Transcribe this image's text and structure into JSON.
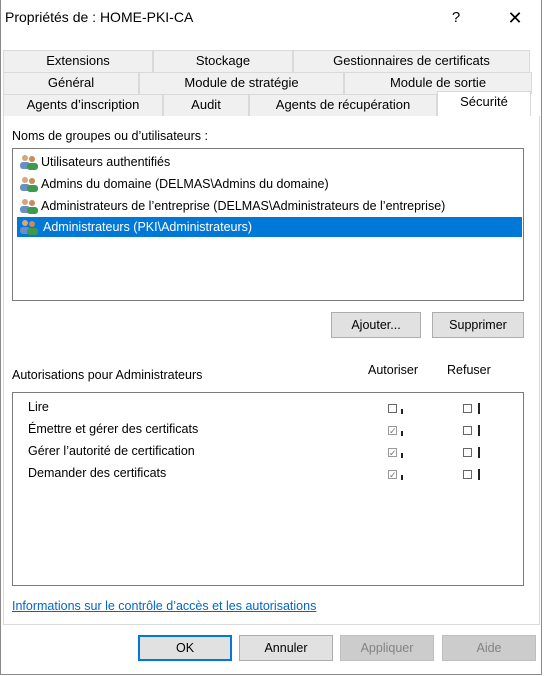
{
  "window": {
    "title": "Propriétés de : HOME-PKI-CA",
    "help_label": "?",
    "close_label": "✕"
  },
  "tabs": {
    "row1": [
      "Extensions",
      "Stockage",
      "Gestionnaires de certificats"
    ],
    "row2": [
      "Général",
      "Module de stratégie",
      "Module de sortie"
    ],
    "row3": [
      "Agents d’inscription",
      "Audit",
      "Agents de récupération",
      "Sécurité"
    ],
    "active": "Sécurité"
  },
  "groups": {
    "label": "Noms de groupes ou d’utilisateurs :",
    "items": [
      {
        "name": "Utilisateurs authentifiés",
        "icon": "users-group-icon"
      },
      {
        "name": "Admins du domaine (DELMAS\\Admins du domaine)",
        "icon": "users-group-icon"
      },
      {
        "name": "Administrateurs de l’entreprise (DELMAS\\Administrateurs de l’entreprise)",
        "icon": "users-group-icon"
      },
      {
        "name": "Administrateurs (PKI\\Administrateurs)",
        "icon": "users-group-icon",
        "selected": true
      }
    ],
    "add_label": "Ajouter...",
    "remove_label": "Supprimer"
  },
  "permissions": {
    "label": "Autorisations pour Administrateurs",
    "allow_header": "Autoriser",
    "deny_header": "Refuser",
    "rows": [
      {
        "name": "Lire",
        "allow": false,
        "deny": false
      },
      {
        "name": "Émettre et gérer des certificats",
        "allow": true,
        "deny": false
      },
      {
        "name": "Gérer l’autorité de certification",
        "allow": true,
        "deny": false
      },
      {
        "name": "Demander des certificats",
        "allow": true,
        "deny": false
      }
    ]
  },
  "link": "Informations sur le contrôle d’accès et les autorisations",
  "footer": {
    "ok": "OK",
    "cancel": "Annuler",
    "apply": "Appliquer",
    "help": "Aide"
  },
  "colors": {
    "selection": "#0078d7",
    "link": "#0066cc",
    "button_face": "#e1e1e1",
    "disabled_button": "#cccccc"
  }
}
